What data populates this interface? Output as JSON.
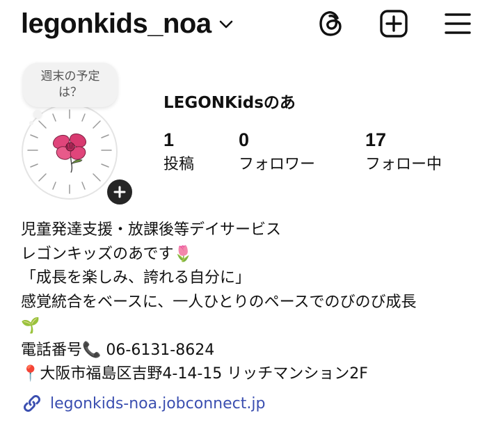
{
  "header": {
    "username": "legonkids_noa",
    "icons": [
      "chevron-down-icon",
      "threads-icon",
      "create-icon",
      "menu-icon"
    ]
  },
  "note": {
    "line1": "週末の予定",
    "line2": "は？"
  },
  "profile": {
    "display_name": "LEGONKidsのあ",
    "stats": [
      {
        "value": "1",
        "label": "投稿"
      },
      {
        "value": "0",
        "label": "フォロワー"
      },
      {
        "value": "17",
        "label": "フォロー中"
      }
    ]
  },
  "bio": {
    "line1": "児童発達支援・放課後等デイサービス",
    "line2": "レゴンキッズのあです🌷",
    "line3": "「成長を楽しみ、誇れる自分に」",
    "line4": "感覚統合をベースに、一人ひとりのペースでのびのび成長",
    "line5": "🌱",
    "line6": "電話番号📞 06-6131-8624",
    "line7": "📍大阪市福島区吉野4-14-15 リッチマンション2F"
  },
  "link": {
    "text": "legonkids-noa.jobconnect.jp"
  },
  "colors": {
    "link": "#3b4fb0",
    "badge": "#262626",
    "note_bg": "#f2f2f2",
    "flower": "#e0457b"
  }
}
